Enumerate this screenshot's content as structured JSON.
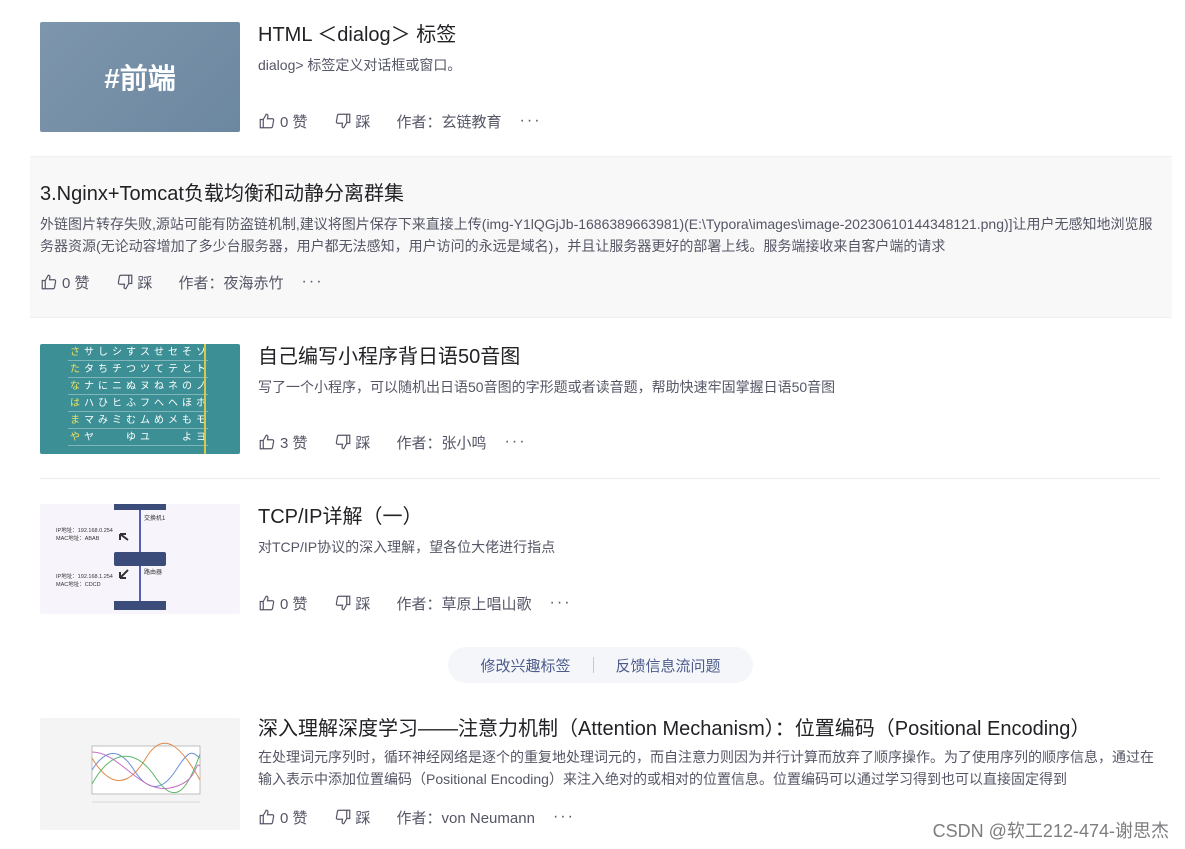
{
  "articles": [
    {
      "title": "HTML ＜dialog＞ 标签",
      "desc": "dialog> 标签定义对话框或窗口。",
      "thumb_text": "#前端",
      "likes": "0 赞",
      "dislike": "踩",
      "author": "作者：玄链教育"
    },
    {
      "title": "3.Nginx+Tomcat负载均衡和动静分离群集",
      "desc": "外链图片转存失败,源站可能有防盗链机制,建议将图片保存下来直接上传(img-Y1lQGjJb-1686389663981)(E:\\Typora\\images\\image-20230610144348121.png)]让用户无感知地浏览服务器资源(无论动容增加了多少台服务器，用户都无法感知，用户访问的永远是域名)，并且让服务器更好的部署上线。服务端接收来自客户端的请求",
      "likes": "0 赞",
      "dislike": "踩",
      "author": "作者：夜海赤竹"
    },
    {
      "title": "自己编写小程序背日语50音图",
      "desc": "写了一个小程序，可以随机出日语50音图的字形题或者读音题，帮助快速牢固掌握日语50音图",
      "likes": "3 赞",
      "dislike": "踩",
      "author": "作者：张小鸣"
    },
    {
      "title": "TCP/IP详解（一）",
      "desc": "对TCP/IP协议的深入理解，望各位大佬进行指点",
      "thumb_labels": [
        "交换机1",
        "IP地址：192.168.0.254",
        "MAC地址：ABAB",
        "路由器",
        "IP地址：192.168.1.254",
        "MAC地址：CDCD"
      ],
      "likes": "0 赞",
      "dislike": "踩",
      "author": "作者：草原上唱山歌"
    },
    {
      "title": "深入理解深度学习——注意力机制（Attention Mechanism）：位置编码（Positional Encoding）",
      "desc": "在处理词元序列时，循环神经网络是逐个的重复地处理词元的，而自注意力则因为并行计算而放弃了顺序操作。为了使用序列的顺序信息，通过在输入表示中添加位置编码（Positional Encoding）来注入绝对的或相对的位置信息。位置编码可以通过学习得到也可以直接固定得到",
      "likes": "0 赞",
      "dislike": "踩",
      "author": "作者：von Neumann"
    }
  ],
  "more": "···",
  "feedback": {
    "edit_tags": "修改兴趣标签",
    "report": "反馈信息流问题"
  },
  "kana_grid": [
    [
      "さ",
      "サ",
      "し",
      "シ",
      "す",
      "ス",
      "せ",
      "セ",
      "そ",
      "ソ"
    ],
    [
      "た",
      "タ",
      "ち",
      "チ",
      "つ",
      "ツ",
      "て",
      "テ",
      "と",
      "ト"
    ],
    [
      "な",
      "ナ",
      "に",
      "ニ",
      "ぬ",
      "ヌ",
      "ね",
      "ネ",
      "の",
      "ノ"
    ],
    [
      "は",
      "ハ",
      "ひ",
      "ヒ",
      "ふ",
      "フ",
      "へ",
      "ヘ",
      "ほ",
      "ホ"
    ],
    [
      "ま",
      "マ",
      "み",
      "ミ",
      "む",
      "ム",
      "め",
      "メ",
      "も",
      "モ"
    ],
    [
      "や",
      "ヤ",
      "",
      "",
      "ゆ",
      "ユ",
      "",
      "",
      "よ",
      "ヨ"
    ]
  ],
  "watermark": "CSDN @软工212-474-谢思杰",
  "colors": {
    "link_blue": "#4c5b8a",
    "text_main": "#222226",
    "text_sub": "#555666"
  }
}
